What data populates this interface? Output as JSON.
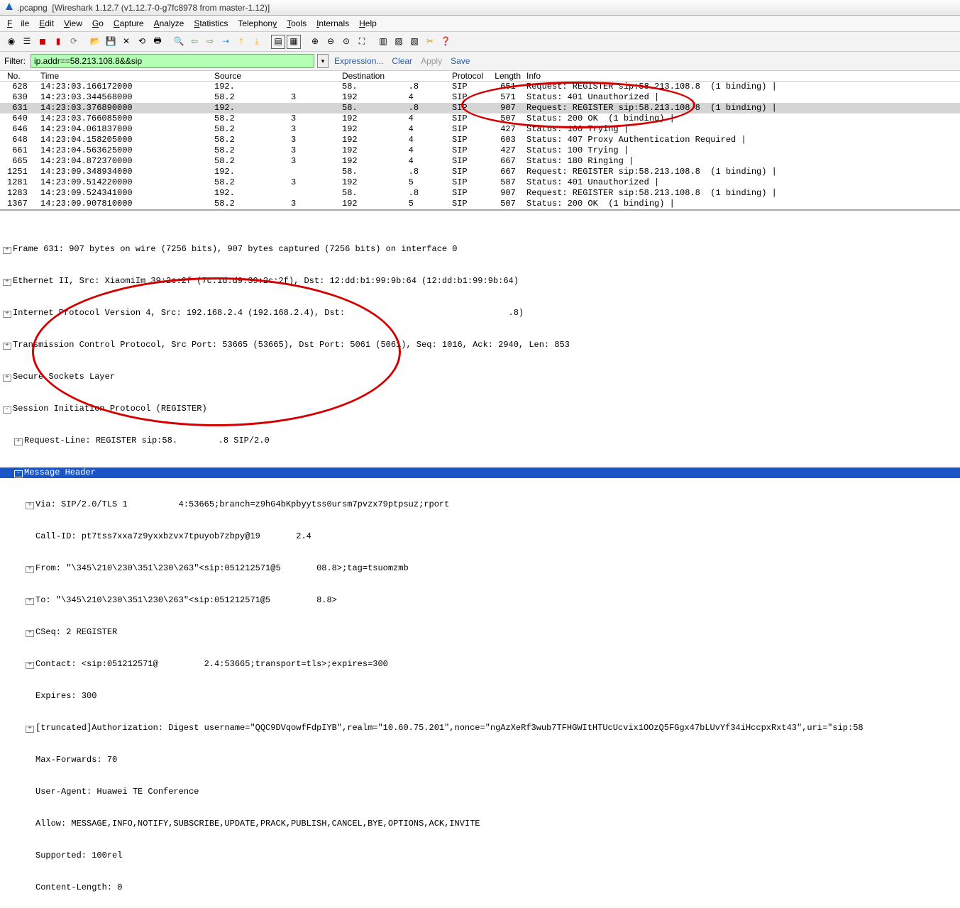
{
  "window": {
    "filename": ".pcapng",
    "app": "[Wireshark 1.12.7  (v1.12.7-0-g7fc8978 from master-1.12)]"
  },
  "menu": {
    "file": "File",
    "edit": "Edit",
    "view": "View",
    "go": "Go",
    "capture": "Capture",
    "analyze": "Analyze",
    "statistics": "Statistics",
    "telephony": "Telephony",
    "tools": "Tools",
    "internals": "Internals",
    "help": "Help"
  },
  "filter": {
    "label": "Filter:",
    "value": "ip.addr==58.213.108.8&&sip",
    "expression": "Expression...",
    "clear": "Clear",
    "apply": "Apply",
    "save": "Save"
  },
  "columns": {
    "no": "No.",
    "time": "Time",
    "src": "Source",
    "dst": "Destination",
    "proto": "Protocol",
    "len": "Length",
    "info": "Info"
  },
  "packets": [
    {
      "no": "628",
      "time": "14:23:03.166172000",
      "src": "192.",
      "dst": "58.          .8",
      "proto": "SIP",
      "len": "651",
      "info": "Request: REGISTER sip:58.213.108.8  (1 binding) |"
    },
    {
      "no": "630",
      "time": "14:23:03.344568000",
      "src": "58.2           3",
      "dst": "192          4",
      "proto": "SIP",
      "len": "571",
      "info": "Status: 401 Unauthorized |"
    },
    {
      "no": "631",
      "time": "14:23:03.376890000",
      "src": "192.",
      "dst": "58.          .8",
      "proto": "SIP",
      "len": "907",
      "info": "Request: REGISTER sip:58.213.108.8  (1 binding) |",
      "sel": true
    },
    {
      "no": "640",
      "time": "14:23:03.766085000",
      "src": "58.2           3",
      "dst": "192          4",
      "proto": "SIP",
      "len": "507",
      "info": "Status: 200 OK  (1 binding) |"
    },
    {
      "no": "646",
      "time": "14:23:04.061837000",
      "src": "58.2           3",
      "dst": "192          4",
      "proto": "SIP",
      "len": "427",
      "info": "Status: 100 Trying |"
    },
    {
      "no": "648",
      "time": "14:23:04.158205000",
      "src": "58.2           3",
      "dst": "192          4",
      "proto": "SIP",
      "len": "603",
      "info": "Status: 407 Proxy Authentication Required |"
    },
    {
      "no": "661",
      "time": "14:23:04.563625000",
      "src": "58.2           3",
      "dst": "192          4",
      "proto": "SIP",
      "len": "427",
      "info": "Status: 100 Trying |"
    },
    {
      "no": "665",
      "time": "14:23:04.872370000",
      "src": "58.2           3",
      "dst": "192          4",
      "proto": "SIP",
      "len": "667",
      "info": "Status: 180 Ringing |"
    },
    {
      "no": "1251",
      "time": "14:23:09.348934000",
      "src": "192.",
      "dst": "58.          .8",
      "proto": "SIP",
      "len": "667",
      "info": "Request: REGISTER sip:58.213.108.8  (1 binding) |"
    },
    {
      "no": "1281",
      "time": "14:23:09.514220000",
      "src": "58.2           3",
      "dst": "192          5",
      "proto": "SIP",
      "len": "587",
      "info": "Status: 401 Unauthorized |"
    },
    {
      "no": "1283",
      "time": "14:23:09.524341000",
      "src": "192.",
      "dst": "58.          .8",
      "proto": "SIP",
      "len": "907",
      "info": "Request: REGISTER sip:58.213.108.8  (1 binding) |"
    },
    {
      "no": "1367",
      "time": "14:23:09.907810000",
      "src": "58.2           3",
      "dst": "192          5",
      "proto": "SIP",
      "len": "507",
      "info": "Status: 200 OK  (1 binding) |"
    }
  ],
  "details": {
    "frame": "Frame 631: 907 bytes on wire (7256 bits), 907 bytes captured (7256 bits) on interface 0",
    "eth": "Ethernet II, Src: XiaomiIm_39:2c:2f (7c:1d:d9:39:2c:2f), Dst: 12:dd:b1:99:9b:64 (12:dd:b1:99:9b:64)",
    "ip": "Internet Protocol Version 4, Src: 192.168.2.4 (192.168.2.4), Dst:                                .8)",
    "tcp": "Transmission Control Protocol, Src Port: 53665 (53665), Dst Port: 5061 (5061), Seq: 1016, Ack: 2940, Len: 853",
    "ssl": "Secure Sockets Layer",
    "sip": "Session Initiation Protocol (REGISTER)",
    "reqline": "Request-Line: REGISTER sip:58.        .8 SIP/2.0",
    "msghdr": "Message Header",
    "via": "Via: SIP/2.0/TLS 1          4:53665;branch=z9hG4bKpbyytss0ursm7pvzx79ptpsuz;rport",
    "callid": "Call-ID: pt7tss7xxa7z9yxxbzvx7tpuyob7zbpy@19       2.4",
    "from": "From: \"\\345\\210\\230\\351\\230\\263\"<sip:051212571@5       08.8>;tag=tsuomzmb",
    "to": "To: \"\\345\\210\\230\\351\\230\\263\"<sip:051212571@5         8.8>",
    "cseq": "CSeq: 2 REGISTER",
    "contact": "Contact: <sip:051212571@         2.4:53665;transport=tls>;expires=300",
    "expires": "Expires: 300",
    "auth": "[truncated]Authorization: Digest username=\"QQC9DVqowfFdpIYB\",realm=\"10.60.75.201\",nonce=\"ngAzXeRf3wub7TFHGWItHTUcUcvix1OOzQ5FGgx47bLUvYf34iHccpxRxt43\",uri=\"sip:58",
    "maxfwd": "Max-Forwards: 70",
    "ua": "User-Agent: Huawei TE Conference",
    "allow": "Allow: MESSAGE,INFO,NOTIFY,SUBSCRIBE,UPDATE,PRACK,PUBLISH,CANCEL,BYE,OPTIONS,ACK,INVITE",
    "supported": "Supported: 100rel",
    "contentlen": "Content-Length: 0"
  }
}
